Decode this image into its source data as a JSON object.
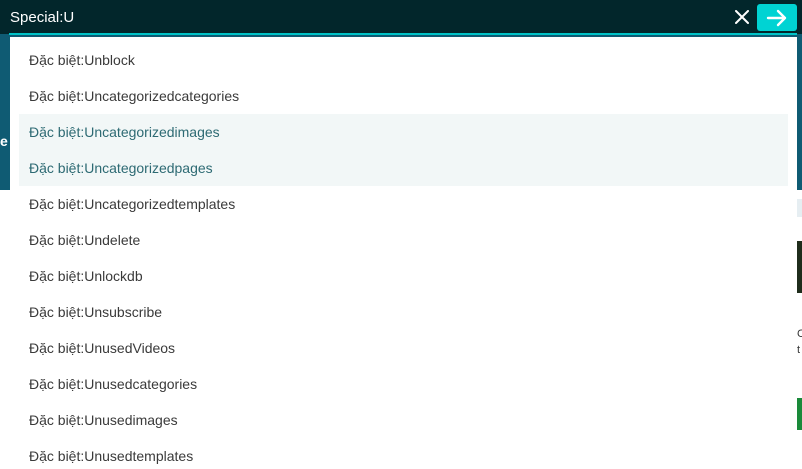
{
  "search": {
    "value": "Special:U",
    "clear_icon": "close-icon",
    "submit_icon": "arrow-right-icon"
  },
  "colors": {
    "search_bar_bg": "#02262b",
    "accent": "#00d3d3",
    "highlight_text": "#2d6a73",
    "highlight_bg": "#f2f7f7"
  },
  "background": {
    "fragment_left": "e",
    "fragment_right": "C\nt"
  },
  "suggestions": [
    {
      "label": "Đặc biệt:Unblock",
      "highlighted": false
    },
    {
      "label": "Đặc biệt:Uncategorizedcategories",
      "highlighted": false
    },
    {
      "label": "Đặc biệt:Uncategorizedimages",
      "highlighted": true
    },
    {
      "label": "Đặc biệt:Uncategorizedpages",
      "highlighted": true
    },
    {
      "label": "Đặc biệt:Uncategorizedtemplates",
      "highlighted": false
    },
    {
      "label": "Đặc biệt:Undelete",
      "highlighted": false
    },
    {
      "label": "Đặc biệt:Unlockdb",
      "highlighted": false
    },
    {
      "label": "Đặc biệt:Unsubscribe",
      "highlighted": false
    },
    {
      "label": "Đặc biệt:UnusedVideos",
      "highlighted": false
    },
    {
      "label": "Đặc biệt:Unusedcategories",
      "highlighted": false
    },
    {
      "label": "Đặc biệt:Unusedimages",
      "highlighted": false
    },
    {
      "label": "Đặc biệt:Unusedtemplates",
      "highlighted": false
    }
  ]
}
